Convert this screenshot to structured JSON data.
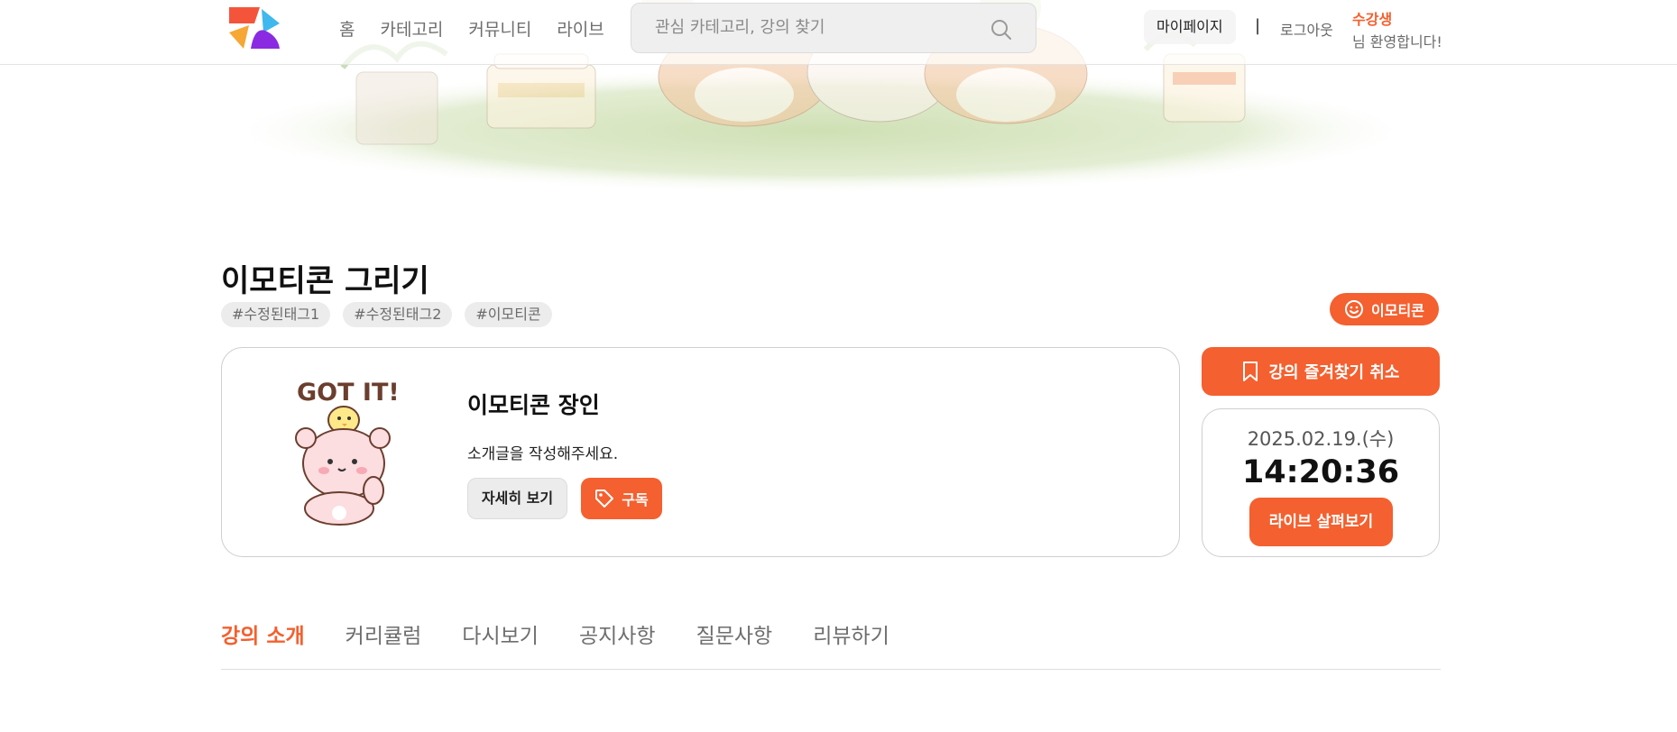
{
  "header": {
    "nav": [
      "홈",
      "카테고리",
      "커뮤니티",
      "라이브"
    ],
    "search_placeholder": "관심 카테고리, 강의 찾기",
    "mypage_label": "마이페이지",
    "divider": "|",
    "logout_label": "로그아웃",
    "welcome_name": "수강생",
    "welcome_msg": "님 환영합니다!"
  },
  "course": {
    "title": "이모티콘 그리기",
    "tags": [
      "#수정된태그1",
      "#수정된태그2",
      "#이모티콘"
    ],
    "category_badge": "이모티콘"
  },
  "instructor": {
    "sticker_text": "GOT IT!",
    "name": "이모티콘 장인",
    "intro": "소개글을 작성해주세요.",
    "detail_label": "자세히 보기",
    "subscribe_label": "구독"
  },
  "side": {
    "favorite_label": "강의 즐겨찾기 취소",
    "live_date": "2025.02.19.(수)",
    "live_time": "14:20:36",
    "live_button": "라이브 살펴보기"
  },
  "tabs": [
    "강의 소개",
    "커리큘럼",
    "다시보기",
    "공지사항",
    "질문사항",
    "리뷰하기"
  ],
  "active_tab": 0,
  "colors": {
    "accent": "#f4602f",
    "logo_red": "#f4553a",
    "logo_blue": "#3fb8ee",
    "logo_orange": "#f7a734",
    "logo_purple": "#8a2be2"
  },
  "icons": {
    "search": "search-icon",
    "bookmark": "bookmark-icon",
    "tag": "tag-icon",
    "smile": "smile-icon"
  }
}
